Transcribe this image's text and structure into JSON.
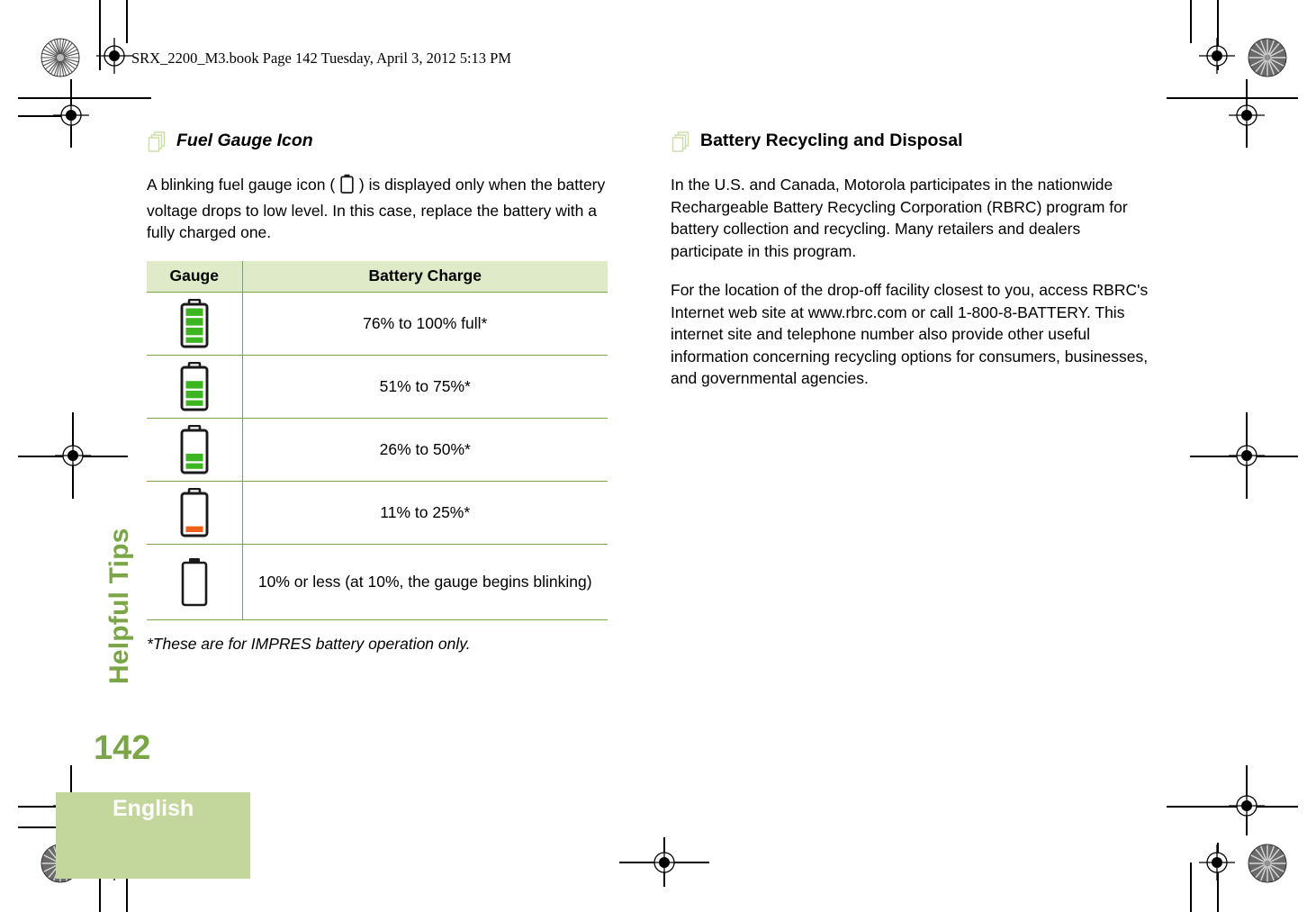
{
  "document": {
    "running_header": "SRX_2200_M3.book  Page 142  Tuesday, April 3, 2012  5:13 PM",
    "page_number": "142",
    "side_tab_label": "Helpful Tips",
    "language_label": "English"
  },
  "colors": {
    "accent_green": "#7ba648",
    "table_header_bg": "#dfeac8",
    "language_band_bg": "#c3d69b",
    "battery_green": "#3cb521",
    "battery_orange": "#ee5f18",
    "icon_outline": "#c9dba6"
  },
  "left_column": {
    "heading": {
      "icon": "pages-stack-icon",
      "title": "Fuel Gauge Icon"
    },
    "intro_paragraph": {
      "before_icon": "A blinking fuel gauge icon ( ",
      "icon": "battery-empty-icon",
      "after_icon": " ) is displayed only when the battery voltage drops to low level. In this case, replace the battery with a fully charged one."
    },
    "table": {
      "columns": [
        "Gauge",
        "Battery Charge"
      ],
      "rows": [
        {
          "gauge_icon": "battery-4-bars-icon",
          "bars": 4,
          "bar_color": "green",
          "charge": "76% to 100% full*"
        },
        {
          "gauge_icon": "battery-3-bars-icon",
          "bars": 3,
          "bar_color": "green",
          "charge": "51% to 75%*"
        },
        {
          "gauge_icon": "battery-2-bars-icon",
          "bars": 2,
          "bar_color": "green",
          "charge": "26% to 50%*"
        },
        {
          "gauge_icon": "battery-1-bar-icon",
          "bars": 1,
          "bar_color": "orange",
          "charge": "11% to 25%*"
        },
        {
          "gauge_icon": "battery-empty-icon",
          "bars": 0,
          "bar_color": "none",
          "charge": "10% or less (at 10%, the gauge begins blinking)"
        }
      ]
    },
    "footnote": "*These are for IMPRES battery operation only."
  },
  "right_column": {
    "heading": {
      "icon": "pages-stack-icon",
      "title": "Battery Recycling and Disposal"
    },
    "paragraphs": [
      "In the U.S. and Canada, Motorola participates in the nationwide Rechargeable Battery Recycling Corporation (RBRC) program for battery collection and recycling. Many retailers and dealers participate in this program.",
      "For the location of the drop-off facility closest to you, access RBRC's Internet web site at www.rbrc.com or call 1-800-8-BATTERY. This internet site and telephone number also provide other useful information concerning recycling options for consumers, businesses, and governmental agencies."
    ]
  },
  "printer_marks": {
    "registration_targets": "registration-target-icon",
    "density_patches": "density-starburst-icon"
  }
}
